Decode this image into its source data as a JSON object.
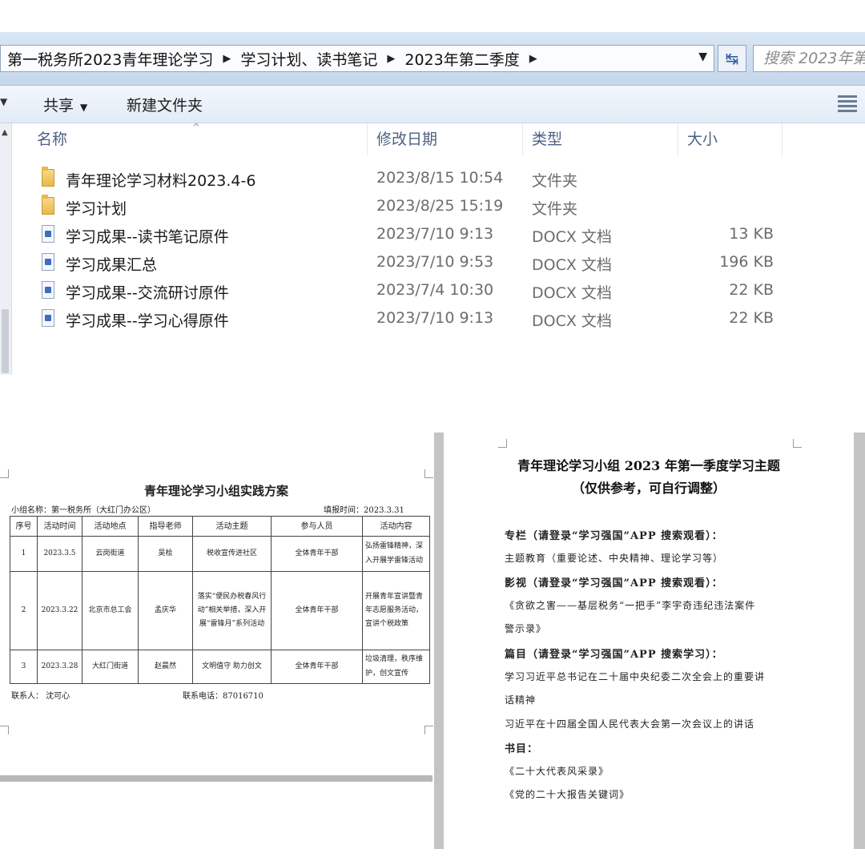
{
  "explorer": {
    "breadcrumb": [
      "第一税务所2023青年理论学习",
      "学习计划、读书笔记",
      "2023年第二季度"
    ],
    "search_placeholder": "搜索 2023年第",
    "toolbar": {
      "share": "共享",
      "new_folder": "新建文件夹"
    },
    "columns": {
      "name": "名称",
      "date": "修改日期",
      "type": "类型",
      "size": "大小"
    },
    "files": [
      {
        "name": "青年理论学习材料2023.4-6",
        "date": "2023/8/15 10:54",
        "type": "文件夹",
        "size": "",
        "icon": "folder-icon"
      },
      {
        "name": "学习计划",
        "date": "2023/8/25 15:19",
        "type": "文件夹",
        "size": "",
        "icon": "folder-icon"
      },
      {
        "name": "学习成果--读书笔记原件",
        "date": "2023/7/10 9:13",
        "type": "DOCX 文档",
        "size": "13 KB",
        "icon": "docx-icon"
      },
      {
        "name": "学习成果汇总",
        "date": "2023/7/10 9:53",
        "type": "DOCX 文档",
        "size": "196 KB",
        "icon": "docx-icon"
      },
      {
        "name": "学习成果--交流研讨原件",
        "date": "2023/7/4 10:30",
        "type": "DOCX 文档",
        "size": "22 KB",
        "icon": "docx-icon"
      },
      {
        "name": "学习成果--学习心得原件",
        "date": "2023/7/10 9:13",
        "type": "DOCX 文档",
        "size": "22 KB",
        "icon": "docx-icon"
      }
    ]
  },
  "plan_doc": {
    "title": "青年理论学习小组实践方案",
    "group_name": "小组名称：第一税务所（大红门办公区）",
    "fill_date": "填报时间：2023.3.31",
    "headers": [
      "序号",
      "活动时间",
      "活动地点",
      "指导老师",
      "活动主题",
      "参与人员",
      "活动内容"
    ],
    "rows": [
      [
        "1",
        "2023.3.5",
        "云岗街道",
        "吴桧",
        "税收宣传进社区",
        "全体青年干部",
        "弘扬雷锋精神，深入开展学雷锋活动"
      ],
      [
        "2",
        "2023.3.22",
        "北京市总工会",
        "孟庆华",
        "落实“便民办税春风行动”相关举措，深入开展“雷锋月”系列活动",
        "全体青年干部",
        "开展青年宣讲暨青年志愿服务活动，宣讲个税政策"
      ],
      [
        "3",
        "2023.3.28",
        "大红门街道",
        "赵晨然",
        "文明值守 助力创文",
        "全体青年干部",
        "垃圾清理，秩序维护，创文宣传"
      ]
    ],
    "contact": "联系人：  沈可心",
    "phone": "联系电话：87016710"
  },
  "topic_doc": {
    "title": "青年理论学习小组 2023 年第一季度学习主题",
    "subtitle": "（仅供参考，可自行调整）",
    "lines": [
      {
        "text": "专栏（请登录“学习强国”APP 搜索观看）：",
        "bold": true
      },
      {
        "text": "主题教育（重要论述、中央精神、理论学习等）",
        "bold": false
      },
      {
        "text": "影视（请登录“学习强国”APP 搜索观看）：",
        "bold": true
      },
      {
        "text": "《贪欲之害——基层税务“一把手”李宇奇违纪违法案件",
        "bold": false
      },
      {
        "text": "警示录》",
        "bold": false
      },
      {
        "text": "篇目（请登录“学习强国”APP 搜索学习）：",
        "bold": true
      },
      {
        "text": "学习习近平总书记在二十届中央纪委二次全会上的重要讲",
        "bold": false
      },
      {
        "text": "话精神",
        "bold": false
      },
      {
        "text": "习近平在十四届全国人民代表大会第一次会议上的讲话",
        "bold": false
      },
      {
        "text": "书目：",
        "bold": true
      },
      {
        "text": "《二十大代表风采录》",
        "bold": false
      },
      {
        "text": "《党的二十大报告关键词》",
        "bold": false
      }
    ]
  }
}
